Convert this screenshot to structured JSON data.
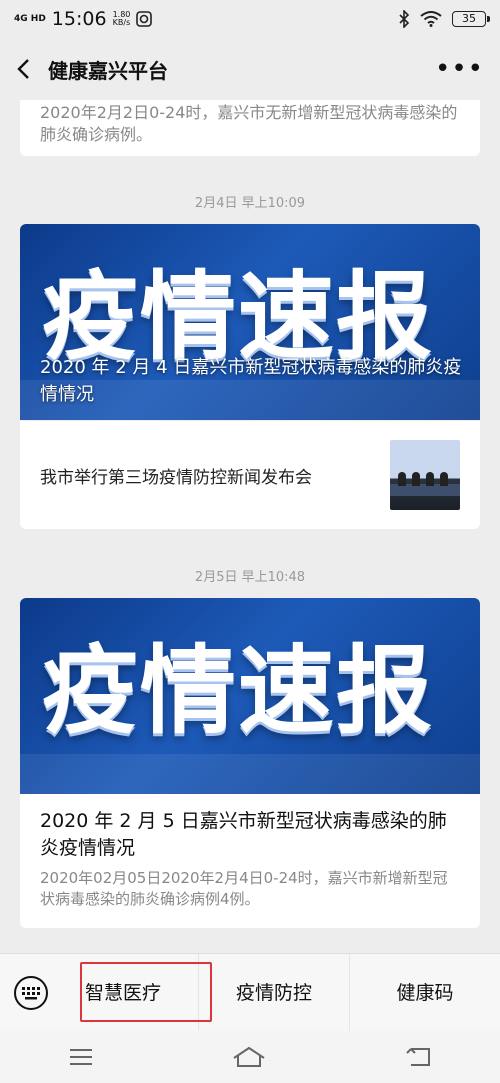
{
  "status_bar": {
    "network": "4G HD",
    "time": "15:06",
    "speed_value": "1.80",
    "speed_unit": "KB/s",
    "battery": "35"
  },
  "nav": {
    "title": "健康嘉兴平台"
  },
  "feed": {
    "prev_card_text": "2020年2月2日0-24时，嘉兴市无新增新型冠状病毒感染的肺炎确诊病例。",
    "groups": [
      {
        "timestamp": "2月4日 早上10:09",
        "cover_text": "疫情速报",
        "cover_title": "2020 年 2 月 4 日嘉兴市新型冠状病毒感染的肺炎疫情情况",
        "sub_article": "我市举行第三场疫情防控新闻发布会"
      },
      {
        "timestamp": "2月5日 早上10:48",
        "cover_text": "疫情速报",
        "title": "2020 年 2 月 5 日嘉兴市新型冠状病毒感染的肺炎疫情情况",
        "desc": "2020年02月05日2020年2月4日0-24时，嘉兴市新增新型冠状病毒感染的肺炎确诊病例4例。"
      }
    ]
  },
  "menu": {
    "items": [
      {
        "label": "智慧医疗"
      },
      {
        "label": "疫情防控"
      },
      {
        "label": "健康码"
      }
    ]
  },
  "colors": {
    "highlight": "#d9363e",
    "cover_blue": "#1d5ab8"
  }
}
